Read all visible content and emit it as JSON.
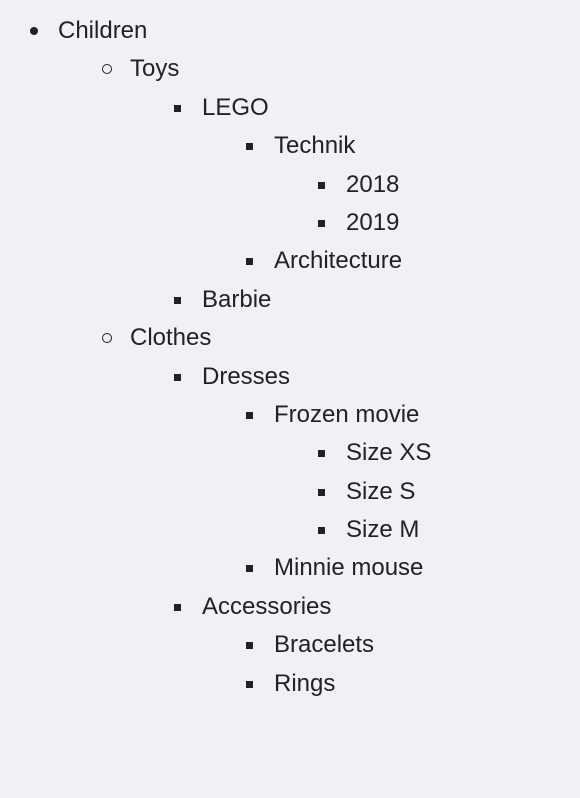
{
  "tree": [
    {
      "label": "Children",
      "children": [
        {
          "label": "Toys",
          "children": [
            {
              "label": "LEGO",
              "children": [
                {
                  "label": "Technik",
                  "children": [
                    {
                      "label": "2018"
                    },
                    {
                      "label": "2019"
                    }
                  ]
                },
                {
                  "label": "Architecture"
                }
              ]
            },
            {
              "label": "Barbie"
            }
          ]
        },
        {
          "label": "Clothes",
          "children": [
            {
              "label": "Dresses",
              "children": [
                {
                  "label": "Frozen movie",
                  "children": [
                    {
                      "label": "Size XS"
                    },
                    {
                      "label": "Size S"
                    },
                    {
                      "label": "Size M"
                    }
                  ]
                },
                {
                  "label": "Minnie mouse"
                }
              ]
            },
            {
              "label": "Accessories",
              "children": [
                {
                  "label": "Bracelets"
                },
                {
                  "label": "Rings"
                }
              ]
            }
          ]
        }
      ]
    }
  ]
}
